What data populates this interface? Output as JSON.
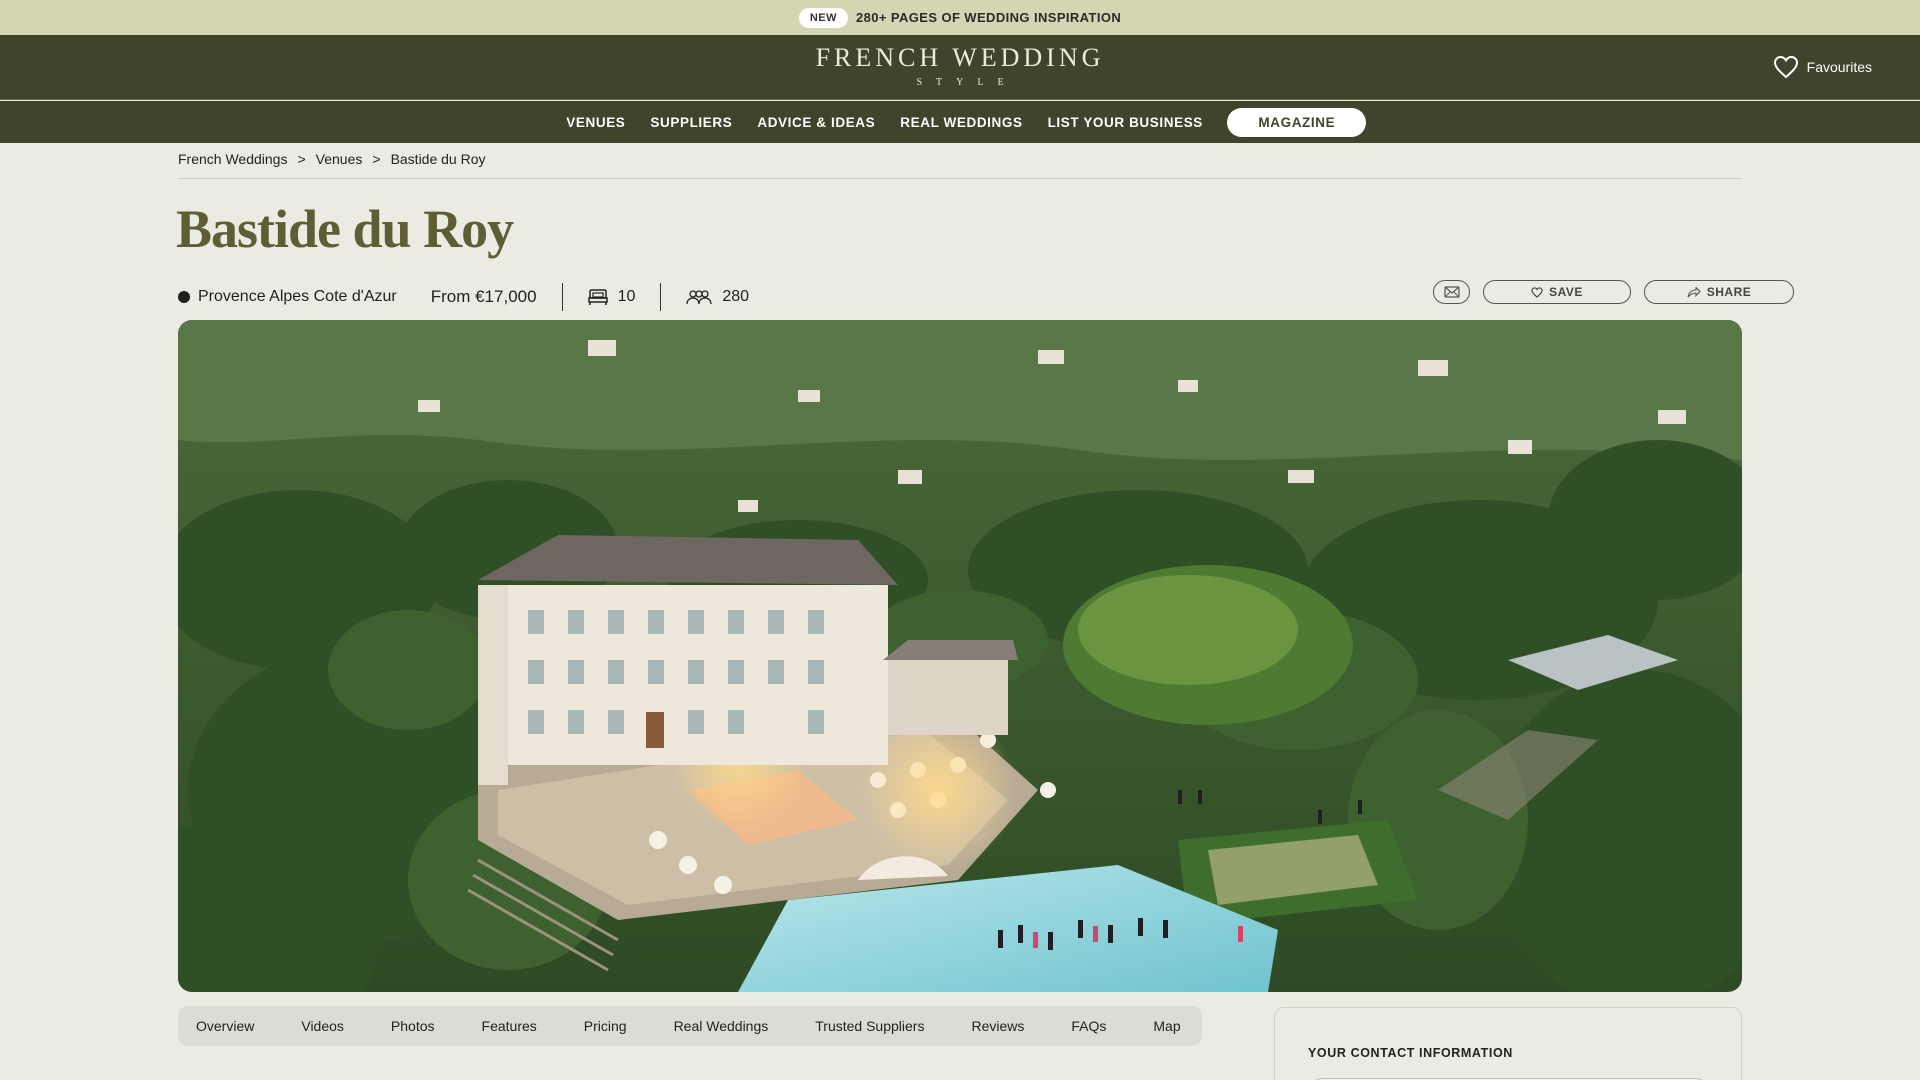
{
  "announcement": {
    "badge": "NEW",
    "text": "280+ PAGES OF WEDDING INSPIRATION"
  },
  "header": {
    "logo_line1": "FRENCH WEDDING",
    "logo_line2": "STYLE",
    "favourites_label": "Favourites"
  },
  "nav": {
    "items": [
      "VENUES",
      "SUPPLIERS",
      "ADVICE & IDEAS",
      "REAL WEDDINGS",
      "LIST YOUR BUSINESS"
    ],
    "magazine": "MAGAZINE"
  },
  "breadcrumb": {
    "items": [
      "French Weddings",
      "Venues",
      "Bastide du Roy"
    ],
    "separator": ">"
  },
  "venue": {
    "name": "Bastide du Roy",
    "region": "Provence Alpes Cote d'Azur",
    "price": "From €17,000",
    "bedrooms": "10",
    "guests": "280",
    "photo_alt": "Aerial view of Bastide du Roy at dusk"
  },
  "actions": {
    "mail_icon": "envelope-icon",
    "save_label": "SAVE",
    "share_label": "SHARE"
  },
  "tabs": [
    "Overview",
    "Videos",
    "Photos",
    "Features",
    "Pricing",
    "Real Weddings",
    "Trusted Suppliers",
    "Reviews",
    "FAQs",
    "Map"
  ],
  "contact": {
    "heading": "YOUR CONTACT INFORMATION"
  },
  "colors": {
    "announce_bg": "#d3d5b3",
    "header_bg": "#40442d",
    "page_bg": "#ecebe3",
    "title_color": "#5f5d33"
  }
}
